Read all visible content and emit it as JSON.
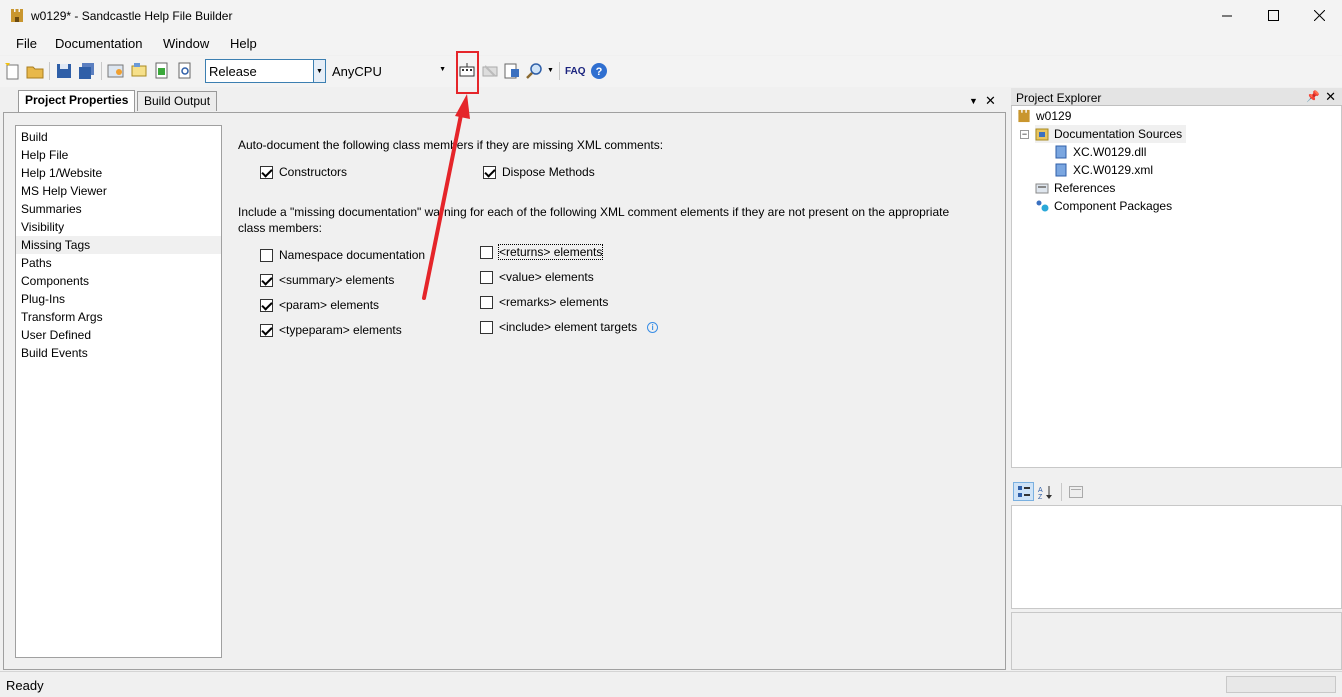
{
  "window": {
    "title": "w0129* - Sandcastle Help File Builder"
  },
  "menu": {
    "file": "File",
    "documentation": "Documentation",
    "window": "Window",
    "help": "Help"
  },
  "toolbar": {
    "configuration": "Release",
    "platform": "AnyCPU",
    "faq": "FAQ"
  },
  "tabs": {
    "project_properties": "Project Properties",
    "build_output": "Build Output"
  },
  "categories": [
    "Build",
    "Help File",
    "Help 1/Website",
    "MS Help Viewer",
    "Summaries",
    "Visibility",
    "Missing Tags",
    "Paths",
    "Components",
    "Plug-Ins",
    "Transform Args",
    "User Defined",
    "Build Events"
  ],
  "selected_category": "Missing Tags",
  "missing_tags": {
    "auto_doc_text": "Auto-document the following class members if they are missing XML comments:",
    "constructors": {
      "label": "Constructors",
      "checked": true
    },
    "dispose": {
      "label": "Dispose Methods",
      "checked": true
    },
    "warning_text_line1": "Include a \"missing documentation\" warning for each of the following XML comment elements if they are not present on the appropriate",
    "warning_text_line2": "class members:",
    "namespace": {
      "label": "Namespace documentation",
      "checked": false
    },
    "summary": {
      "label": "<summary> elements",
      "checked": true
    },
    "param": {
      "label": "<param> elements",
      "checked": true
    },
    "typeparam": {
      "label": "<typeparam> elements",
      "checked": true
    },
    "returns": {
      "label": "<returns> elements",
      "checked": false
    },
    "value": {
      "label": "<value> elements",
      "checked": false
    },
    "remarks": {
      "label": "<remarks> elements",
      "checked": false
    },
    "include": {
      "label": "<include> element targets",
      "checked": false
    }
  },
  "project_explorer": {
    "title": "Project Explorer",
    "root": "w0129",
    "doc_sources": "Documentation Sources",
    "file1": "XC.W0129.dll",
    "file2": "XC.W0129.xml",
    "references": "References",
    "component_packages": "Component Packages"
  },
  "status": {
    "text": "Ready"
  }
}
